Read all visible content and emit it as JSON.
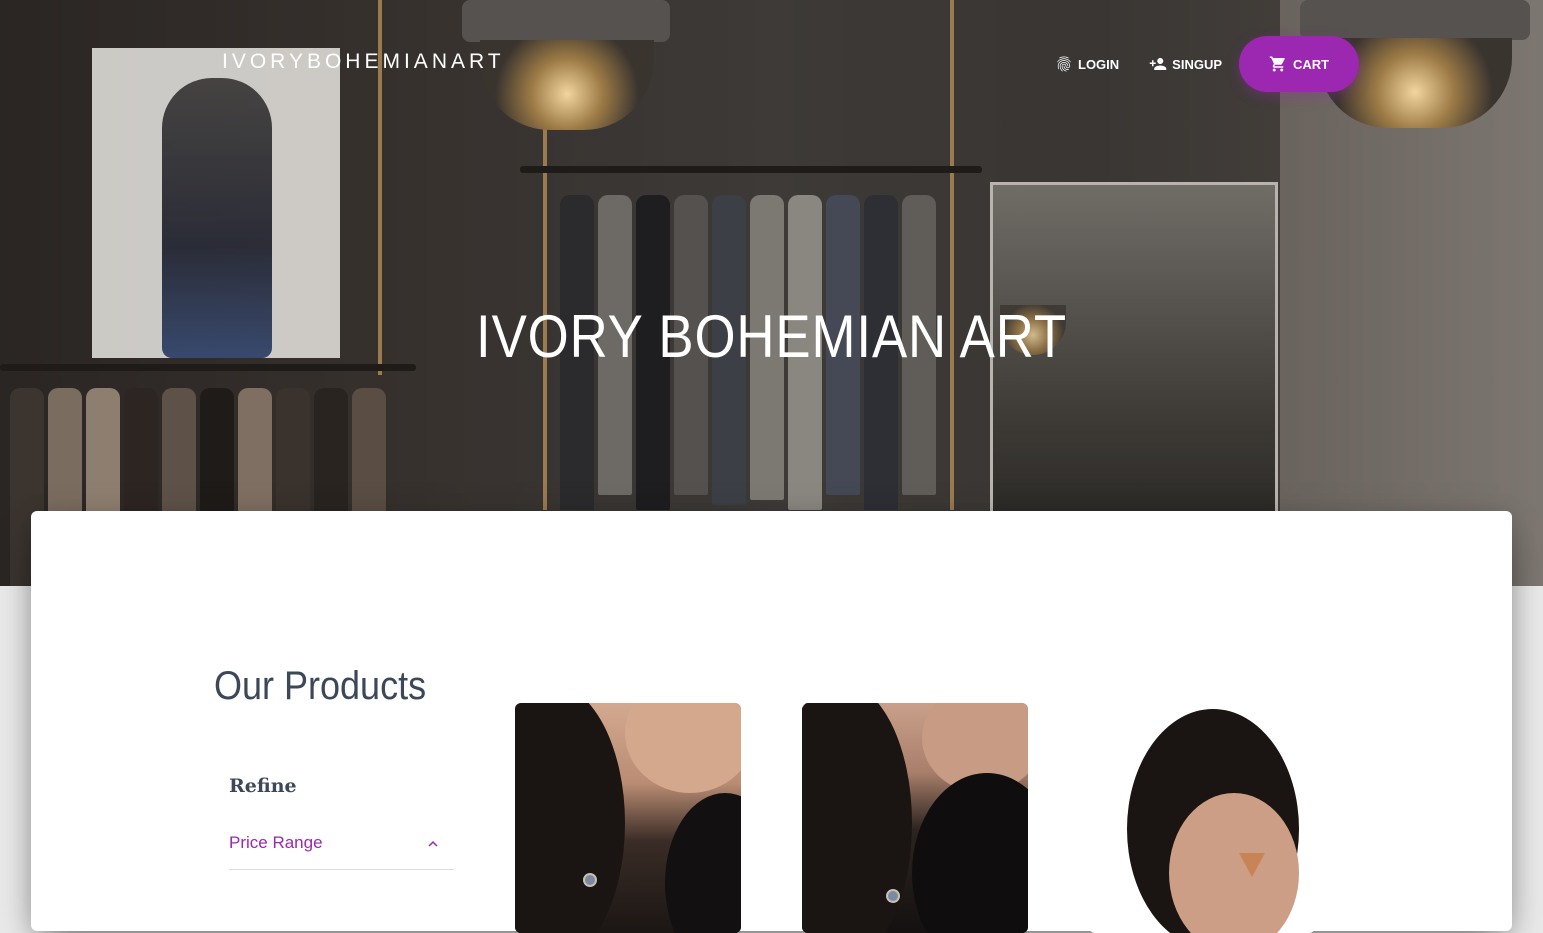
{
  "brand": "IVORYBOHEMIANART",
  "nav": {
    "login": "LOGIN",
    "signup": "SINGUP",
    "cart": "CART"
  },
  "hero": {
    "title": "IVORY BOHEMIAN ART"
  },
  "main": {
    "section_title": "Our Products",
    "refine_title": "Refine",
    "price_range_label": "Price Range"
  },
  "colors": {
    "accent": "#9c27b0",
    "heading": "#3c4858"
  },
  "icons": {
    "login": "fingerprint-icon",
    "signup": "person-add-icon",
    "cart": "shopping-cart-icon",
    "expand": "chevron-up-icon"
  }
}
